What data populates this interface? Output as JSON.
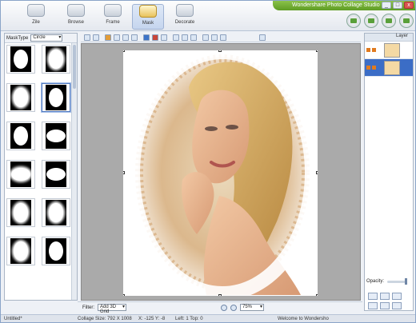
{
  "app": {
    "title": "Wondershare Photo Collage Studio"
  },
  "tabs": [
    {
      "label": "Zile"
    },
    {
      "label": "Browse"
    },
    {
      "label": "Frame"
    },
    {
      "label": "Mask"
    },
    {
      "label": "Decorate"
    }
  ],
  "left_panel": {
    "mask_type_label": "MaskType",
    "mask_type_value": "Circle"
  },
  "bottom": {
    "filter_label": "Filter:",
    "filter_value": "Add 3D Grid",
    "zoom_value": "75%"
  },
  "right_panel": {
    "layer_label": "Layer",
    "opacity_label": "Opacity:"
  },
  "status": {
    "file": "Untitled*",
    "collage_size": "Collage Size: 792 X 1008",
    "coords": "X: -125   Y: -8",
    "left_top": "Left: 1   Top: 0",
    "welcome": "Welcome to Wondersho"
  },
  "colors": {
    "accent_green": "#6aa82f",
    "selection_blue": "#3b6dc6"
  }
}
